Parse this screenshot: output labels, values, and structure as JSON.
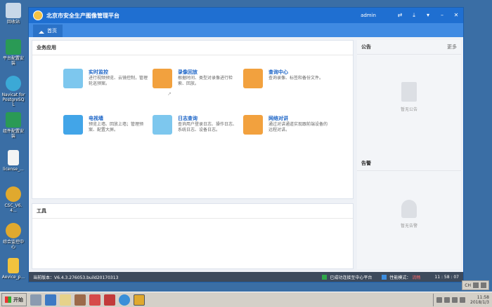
{
  "desktop": {
    "icons": [
      {
        "label": "回收站",
        "color": "#c8d8e8"
      },
      {
        "label": "平台配置安装",
        "color": "#2a9a55"
      },
      {
        "label": "Navicat for PostgreSQL",
        "color": "#3ba9d6"
      },
      {
        "label": "组件配置安装",
        "color": "#2a9a55"
      },
      {
        "label": "license_...",
        "color": "#f4f4f4"
      },
      {
        "label": "CSC_V6.4...",
        "color": "#e0a92e"
      },
      {
        "label": "综合监控中心",
        "color": "#e0a92e"
      },
      {
        "label": "Aevice_p...",
        "color": "#f1c33e"
      }
    ]
  },
  "window": {
    "title": "北京市安全生产图像管理平台",
    "user": "admin",
    "title_icons": [
      "swap-icon",
      "download-icon",
      "dropdown-icon",
      "minimize-icon",
      "close-icon"
    ],
    "tab_label": "首页"
  },
  "business": {
    "title": "业务应用",
    "apps": [
      {
        "name": "实时监控",
        "desc": "进行视频预览、云镜控制，管理轮巡预案。",
        "icon": "camera-icon",
        "color": "#7dc7ee"
      },
      {
        "name": "录像回放",
        "desc": "根据时间、类型对录像进行检索、回放。",
        "icon": "play-icon",
        "color": "#f2a13e"
      },
      {
        "name": "查询中心",
        "desc": "查询录像、标签和备份文件。",
        "icon": "search-icon",
        "color": "#f2a13e"
      },
      {
        "name": "电视墙",
        "desc": "预览上墙、回放上墙；管理预案、配置大屏。",
        "icon": "keyboard-icon",
        "color": "#42a5e8"
      },
      {
        "name": "日志查询",
        "desc": "查询用户登录日志、操作日志、系统日志、设备日志。",
        "icon": "log-search-icon",
        "color": "#7dc7ee"
      },
      {
        "name": "网络对讲",
        "desc": "通过对讲通道实现跟前端设备的远程对讲。",
        "icon": "intercom-icon",
        "color": "#f2a13e"
      }
    ]
  },
  "tools": {
    "title": "工具"
  },
  "notice": {
    "title": "公告",
    "more": "更多",
    "empty": "暂无公告"
  },
  "alarm": {
    "title": "告警",
    "empty": "暂无告警"
  },
  "status": {
    "version": "当前版本：V6.4.3.276053.build20170313",
    "connection": "已成功连接至中心平台",
    "perf_label": "性能模式：",
    "perf_value": "流畅",
    "time": "11 : 58 : 07"
  },
  "taskbar": {
    "start": "开始",
    "lang": "CH",
    "clock_time": "11:58",
    "clock_date": "2018/1/3"
  }
}
